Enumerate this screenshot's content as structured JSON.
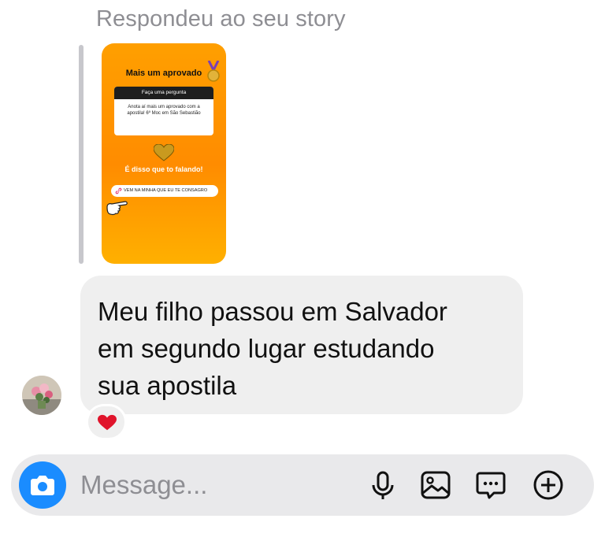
{
  "reply": {
    "header": "Respondeu ao seu story"
  },
  "story": {
    "title": "Mais um aprovado",
    "question_header": "Faça uma pergunta",
    "question_answer": "Anota aí mais um aprovado com a apostila! 6º Moc em São Sebastião",
    "tagline": "É disso que to falando!",
    "link_text": "VEM NA MINHA QUE EU TE CONSAGRO",
    "colors": {
      "gradient_top": "#ff9f00",
      "gradient_bottom": "#ffb000"
    }
  },
  "message": {
    "lines": [
      "Meu filho passou em Salvador",
      "em segundo lugar estudando",
      "sua apostila"
    ],
    "reaction": "heart-icon"
  },
  "composer": {
    "placeholder": "Message...",
    "icons": [
      "camera-icon",
      "microphone-icon",
      "gallery-icon",
      "sticker-icon",
      "plus-icon"
    ],
    "accent": "#1a8cff"
  }
}
